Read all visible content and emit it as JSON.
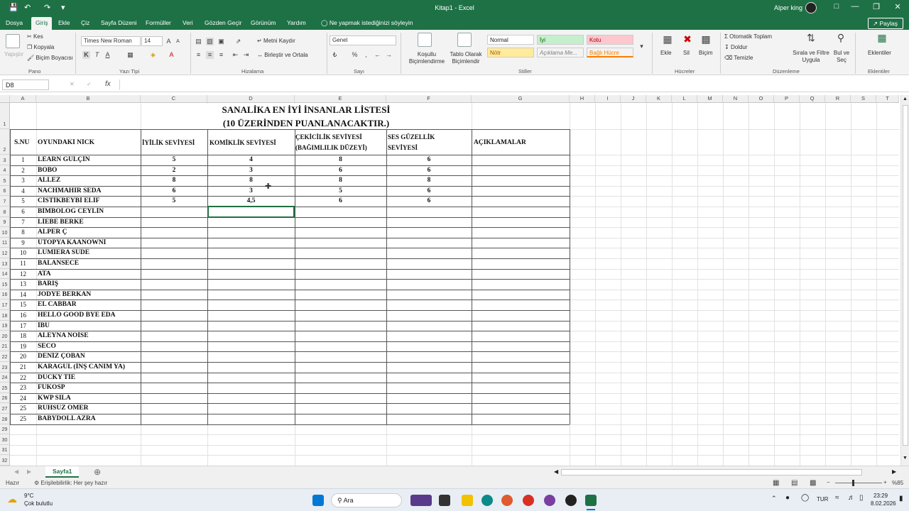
{
  "window": {
    "title": "Kitap1 - Excel",
    "user": "Alper king"
  },
  "tabs": [
    "Dosya",
    "Giriş",
    "Ekle",
    "Çiz",
    "Sayfa Düzeni",
    "Formüller",
    "Veri",
    "Gözden Geçir",
    "Görünüm",
    "Yardım"
  ],
  "tell_me": "Ne yapmak istediğinizi söyleyin",
  "share": "Paylaş",
  "ribbon": {
    "clipboard": {
      "paste": "Yapıştır",
      "cut": "Kes",
      "copy": "Kopyala",
      "painter": "Biçim Boyacısı",
      "group": "Pano"
    },
    "font": {
      "name": "Times New Roman",
      "size": "14",
      "group": "Yazı Tipi"
    },
    "align": {
      "wrap": "Metni Kaydır",
      "merge": "Birleştir ve Ortala",
      "group": "Hizalama"
    },
    "number": {
      "format": "Genel",
      "group": "Sayı"
    },
    "styles": {
      "cond": "Koşullu Biçimlendirme",
      "table": "Tablo Olarak Biçimlendir",
      "normal": "Normal",
      "iyi": "İyi",
      "kotu": "Kotu",
      "notr": "Nötr",
      "aciklama": "Açıklama Me...",
      "bagli": "Bağlı Hücre",
      "group": "Stiller"
    },
    "cells": {
      "insert": "Ekle",
      "delete": "Sil",
      "format": "Biçim",
      "group": "Hücreler"
    },
    "editing": {
      "autosum": "Otomatik Toplam",
      "fill": "Doldur",
      "clear": "Temizle",
      "sort": "Sırala ve Filtre Uygula",
      "find": "Bul ve Seç",
      "group": "Düzenleme"
    },
    "addins": {
      "label": "Eklentiler",
      "group": "Eklentiler"
    }
  },
  "namebox": "D8",
  "columns": [
    "A",
    "B",
    "C",
    "D",
    "E",
    "F",
    "G",
    "H",
    "I",
    "J",
    "K",
    "L",
    "M",
    "N",
    "O",
    "P",
    "Q",
    "R",
    "S",
    "T"
  ],
  "rows": [
    "1",
    "2",
    "3",
    "4",
    "5",
    "6",
    "7",
    "8",
    "9",
    "10",
    "11",
    "12",
    "13",
    "14",
    "15",
    "16",
    "17",
    "18",
    "19",
    "20",
    "21",
    "22",
    "23",
    "24",
    "25",
    "26",
    "27",
    "28",
    "29",
    "30",
    "31",
    "32",
    "33"
  ],
  "sheet": {
    "title1": "SANALİKA EN İYİ İNSANLAR LİSTESİ",
    "title2": "(10 ÜZERİNDEN PUANLANACAKTIR.)",
    "headers": {
      "no": "S.NU",
      "nick": "OYUNDAKİ NİCK",
      "iyilik": "İYİLİK SEVİYESİ",
      "komiklik": "KOMİKLİK SEVİYESİ",
      "cekicilik": "ÇEKİCİLİK SEVİYESİ (BAĞIMLILIK DÜZEYİ)",
      "cekicilik1": "ÇEKİCİLİK SEVİYESİ",
      "cekicilik2": "(BAĞIMLILIK DÜZEYİ)",
      "ses1": "SES GÜZELLİK",
      "ses2": "SEVİYESİ",
      "aciklama": "AÇIKLAMALAR"
    },
    "entries": [
      {
        "no": "1",
        "nick": "LEARN GÜLÇİN",
        "iyilik": "5",
        "komiklik": "4",
        "cekicilik": "8",
        "ses": "6"
      },
      {
        "no": "2",
        "nick": "BOBO",
        "iyilik": "2",
        "komiklik": "3",
        "cekicilik": "6",
        "ses": "6"
      },
      {
        "no": "3",
        "nick": "ALLEZ",
        "iyilik": "8",
        "komiklik": "8",
        "cekicilik": "8",
        "ses": "8"
      },
      {
        "no": "4",
        "nick": "NACHMAHIR SEDA",
        "iyilik": "6",
        "komiklik": "3",
        "cekicilik": "5",
        "ses": "6"
      },
      {
        "no": "5",
        "nick": "CİSTİKBEYBİ ELİF",
        "iyilik": "5",
        "komiklik": "4,5",
        "cekicilik": "6",
        "ses": "6"
      },
      {
        "no": "6",
        "nick": "BİMBOLOG CEYLİN",
        "iyilik": "",
        "komiklik": "",
        "cekicilik": "",
        "ses": ""
      },
      {
        "no": "7",
        "nick": "LİEBE BERKE",
        "iyilik": "",
        "komiklik": "",
        "cekicilik": "",
        "ses": ""
      },
      {
        "no": "8",
        "nick": "ALPER Ç",
        "iyilik": "",
        "komiklik": "",
        "cekicilik": "",
        "ses": ""
      },
      {
        "no": "9",
        "nick": "ÜTOPYA KAANOWNİ",
        "iyilik": "",
        "komiklik": "",
        "cekicilik": "",
        "ses": ""
      },
      {
        "no": "10",
        "nick": "LUMİERA SUDE",
        "iyilik": "",
        "komiklik": "",
        "cekicilik": "",
        "ses": ""
      },
      {
        "no": "11",
        "nick": "BALANSECE",
        "iyilik": "",
        "komiklik": "",
        "cekicilik": "",
        "ses": ""
      },
      {
        "no": "12",
        "nick": "ATA",
        "iyilik": "",
        "komiklik": "",
        "cekicilik": "",
        "ses": ""
      },
      {
        "no": "13",
        "nick": "BARIŞ",
        "iyilik": "",
        "komiklik": "",
        "cekicilik": "",
        "ses": ""
      },
      {
        "no": "14",
        "nick": "JODYE BERKAN",
        "iyilik": "",
        "komiklik": "",
        "cekicilik": "",
        "ses": ""
      },
      {
        "no": "15",
        "nick": "EL CABBAR",
        "iyilik": "",
        "komiklik": "",
        "cekicilik": "",
        "ses": ""
      },
      {
        "no": "16",
        "nick": "HELLO GOOD BYE EDA",
        "iyilik": "",
        "komiklik": "",
        "cekicilik": "",
        "ses": ""
      },
      {
        "no": "17",
        "nick": "İBU",
        "iyilik": "",
        "komiklik": "",
        "cekicilik": "",
        "ses": ""
      },
      {
        "no": "18",
        "nick": "ALEYNA NOİSE",
        "iyilik": "",
        "komiklik": "",
        "cekicilik": "",
        "ses": ""
      },
      {
        "no": "19",
        "nick": "SECO",
        "iyilik": "",
        "komiklik": "",
        "cekicilik": "",
        "ses": ""
      },
      {
        "no": "20",
        "nick": "DENİZ ÇOBAN",
        "iyilik": "",
        "komiklik": "",
        "cekicilik": "",
        "ses": ""
      },
      {
        "no": "21",
        "nick": "KARAGÜL (İNŞ CANIM YA)",
        "iyilik": "",
        "komiklik": "",
        "cekicilik": "",
        "ses": ""
      },
      {
        "no": "22",
        "nick": "DUCKY TİE",
        "iyilik": "",
        "komiklik": "",
        "cekicilik": "",
        "ses": ""
      },
      {
        "no": "23",
        "nick": "FUKOSP",
        "iyilik": "",
        "komiklik": "",
        "cekicilik": "",
        "ses": ""
      },
      {
        "no": "24",
        "nick": "KWP SILA",
        "iyilik": "",
        "komiklik": "",
        "cekicilik": "",
        "ses": ""
      },
      {
        "no": "25",
        "nick": "RUHSUZ ÖMER",
        "iyilik": "",
        "komiklik": "",
        "cekicilik": "",
        "ses": ""
      },
      {
        "no": "25",
        "nick": "BABYDOLL AZRA",
        "iyilik": "",
        "komiklik": "",
        "cekicilik": "",
        "ses": ""
      }
    ]
  },
  "sheet_tab": "Sayfa1",
  "status": {
    "ready": "Hazır",
    "access": "Erişilebilirlik: Her şey hazır",
    "zoom": "%85"
  },
  "taskbar": {
    "temp": "9°C",
    "weather": "Çok bulutlu",
    "search": "Ara",
    "lang": "TUR",
    "time": "23:29",
    "date": "8.02.2026"
  },
  "colors": {
    "excel_green": "#1e7145",
    "selection": "#1e7145"
  }
}
